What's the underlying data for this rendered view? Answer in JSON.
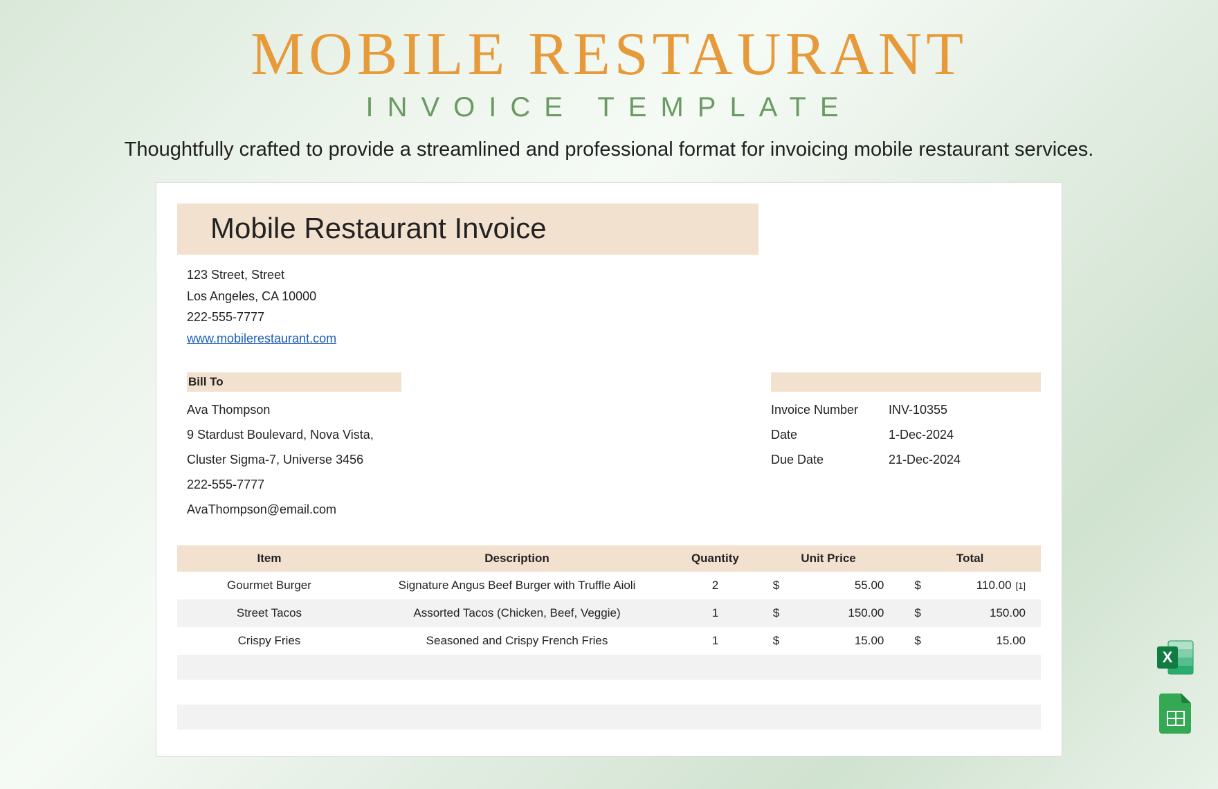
{
  "hero": {
    "title": "MOBILE RESTAURANT",
    "subtitle": "INVOICE TEMPLATE",
    "description": "Thoughtfully crafted to provide a streamlined and professional format for invoicing mobile restaurant services."
  },
  "doc": {
    "title": "Mobile Restaurant Invoice",
    "company": {
      "address1": "123 Street, Street",
      "address2": "Los Angeles, CA 10000",
      "phone": "222-555-7777",
      "website": "www.mobilerestaurant.com"
    },
    "bill_to_label": "Bill To",
    "bill_to": {
      "name": "Ava Thompson",
      "address1": "9 Stardust Boulevard, Nova Vista,",
      "address2": "Cluster Sigma-7, Universe 3456",
      "phone": "222-555-7777",
      "email": "AvaThompson@email.com"
    },
    "meta": {
      "invoice_number_label": "Invoice Number",
      "invoice_number": "INV-10355",
      "date_label": "Date",
      "date": "1-Dec-2024",
      "due_date_label": "Due Date",
      "due_date": "21-Dec-2024"
    },
    "columns": {
      "item": "Item",
      "description": "Description",
      "quantity": "Quantity",
      "unit_price": "Unit Price",
      "total": "Total"
    },
    "currency": "$",
    "items": [
      {
        "item": "Gourmet Burger",
        "description": "Signature Angus Beef Burger with Truffle Aioli",
        "quantity": "2",
        "unit_price": "55.00",
        "total": "110.00",
        "note": "[1]"
      },
      {
        "item": "Street Tacos",
        "description": "Assorted Tacos (Chicken, Beef, Veggie)",
        "quantity": "1",
        "unit_price": "150.00",
        "total": "150.00",
        "note": ""
      },
      {
        "item": "Crispy Fries",
        "description": "Seasoned and Crispy French Fries",
        "quantity": "1",
        "unit_price": "15.00",
        "total": "15.00",
        "note": ""
      }
    ]
  },
  "icons": {
    "excel": "excel-icon",
    "sheets": "sheets-icon"
  }
}
